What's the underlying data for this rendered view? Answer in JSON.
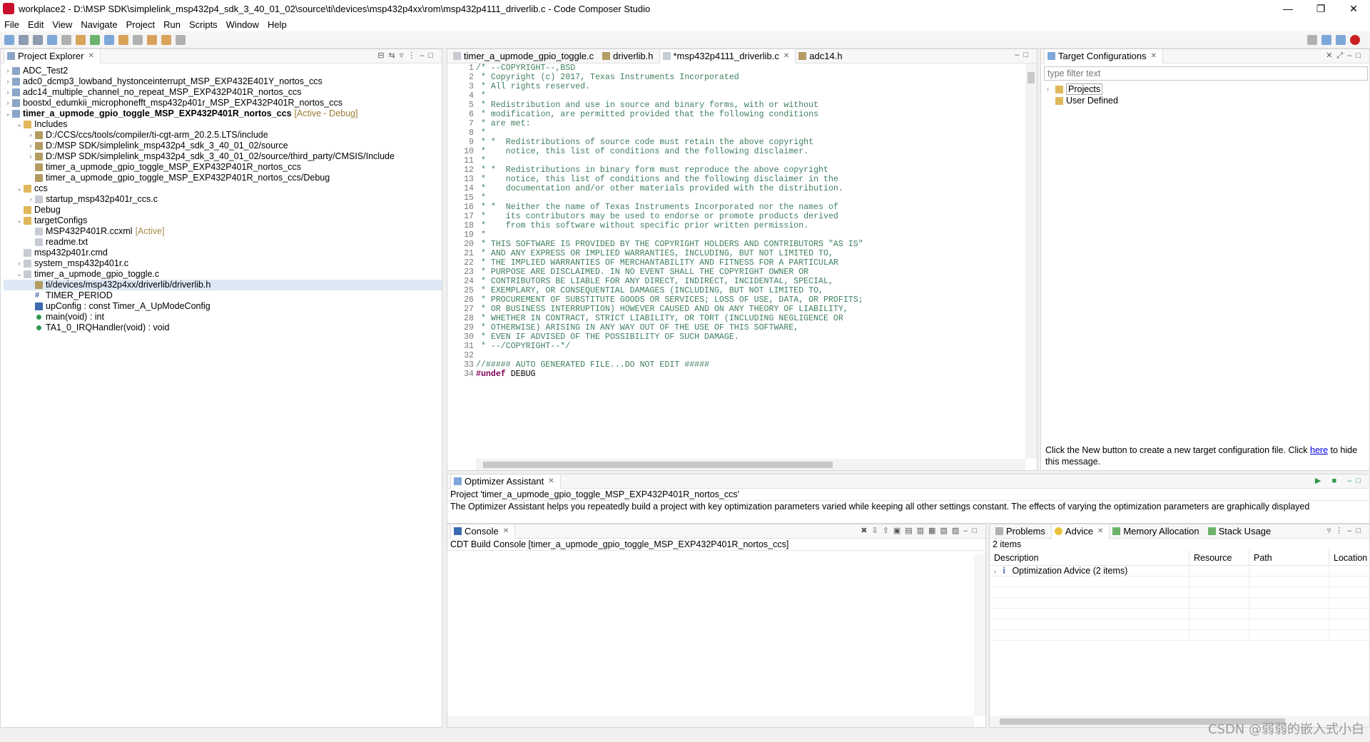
{
  "window": {
    "title": "workplace2 - D:\\MSP SDK\\simplelink_msp432p4_sdk_3_40_01_02\\source\\ti\\devices\\msp432p4xx\\rom\\msp432p4111_driverlib.c - Code Composer Studio",
    "minimize": "—",
    "restore": "❐",
    "close": "✕"
  },
  "menu": [
    "File",
    "Edit",
    "View",
    "Navigate",
    "Project",
    "Run",
    "Scripts",
    "Window",
    "Help"
  ],
  "project_explorer": {
    "title": "Project Explorer",
    "items": [
      {
        "label": "ADC_Test2",
        "depth": 0,
        "icon": "project-icon",
        "twisty": "›"
      },
      {
        "label": "adc0_dcmp3_lowband_hystonceinterrupt_MSP_EXP432E401Y_nortos_ccs",
        "depth": 0,
        "icon": "project-icon",
        "twisty": "›"
      },
      {
        "label": "adc14_multiple_channel_no_repeat_MSP_EXP432P401R_nortos_ccs",
        "depth": 0,
        "icon": "project-icon",
        "twisty": "›"
      },
      {
        "label": "boostxl_edumkii_microphonefft_msp432p401r_MSP_EXP432P401R_nortos_ccs",
        "depth": 0,
        "icon": "project-icon",
        "twisty": "›"
      },
      {
        "label": "timer_a_upmode_gpio_toggle_MSP_EXP432P401R_nortos_ccs",
        "depth": 0,
        "icon": "project-icon",
        "twisty": "⌄",
        "bold": true,
        "tag": "[Active - Debug]"
      },
      {
        "label": "Includes",
        "depth": 1,
        "icon": "folder-icon",
        "twisty": "⌄"
      },
      {
        "label": "D:/CCS/ccs/tools/compiler/ti-cgt-arm_20.2.5.LTS/include",
        "depth": 2,
        "icon": "include-icon",
        "twisty": "›"
      },
      {
        "label": "D:/MSP SDK/simplelink_msp432p4_sdk_3_40_01_02/source",
        "depth": 2,
        "icon": "include-icon",
        "twisty": "›"
      },
      {
        "label": "D:/MSP SDK/simplelink_msp432p4_sdk_3_40_01_02/source/third_party/CMSIS/Include",
        "depth": 2,
        "icon": "include-icon",
        "twisty": "›"
      },
      {
        "label": "timer_a_upmode_gpio_toggle_MSP_EXP432P401R_nortos_ccs",
        "depth": 2,
        "icon": "include-icon",
        "twisty": ""
      },
      {
        "label": "timer_a_upmode_gpio_toggle_MSP_EXP432P401R_nortos_ccs/Debug",
        "depth": 2,
        "icon": "include-icon",
        "twisty": ""
      },
      {
        "label": "ccs",
        "depth": 1,
        "icon": "folder-icon",
        "twisty": "⌄"
      },
      {
        "label": "startup_msp432p401r_ccs.c",
        "depth": 2,
        "icon": "file-icon",
        "twisty": "›"
      },
      {
        "label": "Debug",
        "depth": 1,
        "icon": "folder-icon",
        "twisty": ""
      },
      {
        "label": "targetConfigs",
        "depth": 1,
        "icon": "folder-icon",
        "twisty": "⌄"
      },
      {
        "label": "MSP432P401R.ccxml",
        "depth": 2,
        "icon": "file-icon",
        "twisty": "",
        "tag2": "[Active]"
      },
      {
        "label": "readme.txt",
        "depth": 2,
        "icon": "file-icon",
        "twisty": ""
      },
      {
        "label": "msp432p401r.cmd",
        "depth": 1,
        "icon": "file-icon",
        "twisty": ""
      },
      {
        "label": "system_msp432p401r.c",
        "depth": 1,
        "icon": "file-icon",
        "twisty": "›"
      },
      {
        "label": "timer_a_upmode_gpio_toggle.c",
        "depth": 1,
        "icon": "file-icon",
        "twisty": "⌄"
      },
      {
        "label": "ti/devices/msp432p4xx/driverlib/driverlib.h",
        "depth": 2,
        "icon": "include-icon",
        "twisty": "",
        "selected": true
      },
      {
        "label": "TIMER_PERIOD",
        "depth": 2,
        "icon": "hash-icon",
        "twisty": ""
      },
      {
        "label": "upConfig : const Timer_A_UpModeConfig",
        "depth": 2,
        "icon": "field-icon",
        "twisty": ""
      },
      {
        "label": "main(void) : int",
        "depth": 2,
        "icon": "function-icon",
        "twisty": ""
      },
      {
        "label": "TA1_0_IRQHandler(void) : void",
        "depth": 2,
        "icon": "function-icon",
        "twisty": ""
      }
    ]
  },
  "editor": {
    "tabs": [
      {
        "label": "timer_a_upmode_gpio_toggle.c",
        "active": false
      },
      {
        "label": "driverlib.h",
        "active": false
      },
      {
        "label": "*msp432p4111_driverlib.c",
        "active": true
      },
      {
        "label": "adc14.h",
        "active": false
      }
    ],
    "lines": [
      {
        "n": "1",
        "text": "/* --COPYRIGHT--,BSD",
        "kind": "cmt"
      },
      {
        "n": "2",
        "text": " * Copyright (c) 2017, Texas Instruments Incorporated",
        "kind": "cmt"
      },
      {
        "n": "3",
        "text": " * All rights reserved.",
        "kind": "cmt"
      },
      {
        "n": "4",
        "text": " *",
        "kind": "cmt"
      },
      {
        "n": "5",
        "text": " * Redistribution and use in source and binary forms, with or without",
        "kind": "cmt"
      },
      {
        "n": "6",
        "text": " * modification, are permitted provided that the following conditions",
        "kind": "cmt"
      },
      {
        "n": "7",
        "text": " * are met:",
        "kind": "cmt"
      },
      {
        "n": "8",
        "text": " *",
        "kind": "cmt"
      },
      {
        "n": "9",
        "text": " * *  Redistributions of source code must retain the above copyright",
        "kind": "cmt"
      },
      {
        "n": "10",
        "text": " *    notice, this list of conditions and the following disclaimer.",
        "kind": "cmt"
      },
      {
        "n": "11",
        "text": " *",
        "kind": "cmt"
      },
      {
        "n": "12",
        "text": " * *  Redistributions in binary form must reproduce the above copyright",
        "kind": "cmt"
      },
      {
        "n": "13",
        "text": " *    notice, this list of conditions and the following disclaimer in the",
        "kind": "cmt"
      },
      {
        "n": "14",
        "text": " *    documentation and/or other materials provided with the distribution.",
        "kind": "cmt"
      },
      {
        "n": "15",
        "text": " *",
        "kind": "cmt"
      },
      {
        "n": "16",
        "text": " * *  Neither the name of Texas Instruments Incorporated nor the names of",
        "kind": "cmt"
      },
      {
        "n": "17",
        "text": " *    its contributors may be used to endorse or promote products derived",
        "kind": "cmt"
      },
      {
        "n": "18",
        "text": " *    from this software without specific prior written permission.",
        "kind": "cmt"
      },
      {
        "n": "19",
        "text": " *",
        "kind": "cmt"
      },
      {
        "n": "20",
        "text": " * THIS SOFTWARE IS PROVIDED BY THE COPYRIGHT HOLDERS AND CONTRIBUTORS \"AS IS\"",
        "kind": "cmt"
      },
      {
        "n": "21",
        "text": " * AND ANY EXPRESS OR IMPLIED WARRANTIES, INCLUDING, BUT NOT LIMITED TO,",
        "kind": "cmt"
      },
      {
        "n": "22",
        "text": " * THE IMPLIED WARRANTIES OF MERCHANTABILITY AND FITNESS FOR A PARTICULAR",
        "kind": "cmt"
      },
      {
        "n": "23",
        "text": " * PURPOSE ARE DISCLAIMED. IN NO EVENT SHALL THE COPYRIGHT OWNER OR",
        "kind": "cmt"
      },
      {
        "n": "24",
        "text": " * CONTRIBUTORS BE LIABLE FOR ANY DIRECT, INDIRECT, INCIDENTAL, SPECIAL,",
        "kind": "cmt"
      },
      {
        "n": "25",
        "text": " * EXEMPLARY, OR CONSEQUENTIAL DAMAGES (INCLUDING, BUT NOT LIMITED TO,",
        "kind": "cmt"
      },
      {
        "n": "26",
        "text": " * PROCUREMENT OF SUBSTITUTE GOODS OR SERVICES; LOSS OF USE, DATA, OR PROFITS;",
        "kind": "cmt"
      },
      {
        "n": "27",
        "text": " * OR BUSINESS INTERRUPTION) HOWEVER CAUSED AND ON ANY THEORY OF LIABILITY,",
        "kind": "cmt"
      },
      {
        "n": "28",
        "text": " * WHETHER IN CONTRACT, STRICT LIABILITY, OR TORT (INCLUDING NEGLIGENCE OR",
        "kind": "cmt"
      },
      {
        "n": "29",
        "text": " * OTHERWISE) ARISING IN ANY WAY OUT OF THE USE OF THIS SOFTWARE,",
        "kind": "cmt"
      },
      {
        "n": "30",
        "text": " * EVEN IF ADVISED OF THE POSSIBILITY OF SUCH DAMAGE.",
        "kind": "cmt"
      },
      {
        "n": "31",
        "text": " * --/COPYRIGHT--*/",
        "kind": "cmt"
      },
      {
        "n": "32",
        "text": "",
        "kind": "plain"
      },
      {
        "n": "33",
        "text": "//##### AUTO GENERATED FILE...DO NOT EDIT #####",
        "kind": "cmt"
      },
      {
        "n": "34",
        "text": "#undef DEBUG",
        "kind": "pp"
      }
    ]
  },
  "target_configurations": {
    "title": "Target Configurations",
    "filter_placeholder": "type filter text",
    "items": [
      "Projects",
      "User Defined"
    ],
    "message_before": "Click the New button to create a new target configuration file. Click ",
    "message_link": "here",
    "message_after": " to hide this message."
  },
  "optimizer": {
    "title": "Optimizer Assistant",
    "project_line": "Project 'timer_a_upmode_gpio_toggle_MSP_EXP432P401R_nortos_ccs'",
    "description": "The Optimizer Assistant helps you repeatedly build a project with key optimization parameters varied while keeping all other settings constant. The effects of varying the optimization parameters are graphically displayed"
  },
  "console": {
    "title": "Console",
    "subtitle": "CDT Build Console [timer_a_upmode_gpio_toggle_MSP_EXP432P401R_nortos_ccs]"
  },
  "problems": {
    "tabs": [
      "Problems",
      "Advice",
      "Memory Allocation",
      "Stack Usage"
    ],
    "count": "2 items",
    "columns": [
      "Description",
      "Resource",
      "Path",
      "Location"
    ],
    "rows": [
      {
        "description": "Optimization Advice (2 items)",
        "resource": "",
        "path": "",
        "location": ""
      }
    ]
  },
  "watermark": "CSDN @弱弱的嵌入式小白"
}
